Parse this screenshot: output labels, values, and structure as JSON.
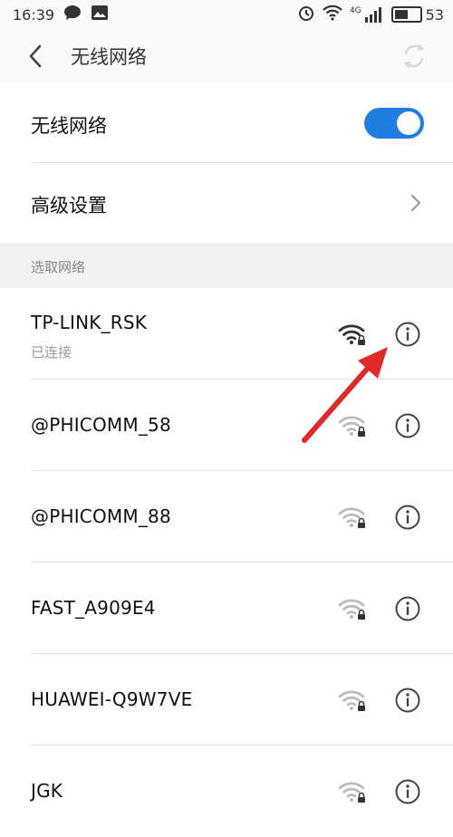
{
  "status": {
    "time": "16:39",
    "network_type": "4G",
    "battery": "53",
    "battery_level": 0.53
  },
  "header": {
    "title": "无线网络",
    "back_icon": "chevron-left-icon",
    "refresh_icon": "refresh-icon"
  },
  "wifi_toggle": {
    "label": "无线网络",
    "on": true,
    "accent": "#1e7fe0"
  },
  "advanced": {
    "label": "高级设置"
  },
  "section": {
    "title": "选取网络"
  },
  "networks": [
    {
      "ssid": "TP-LINK_RSK",
      "status": "已连接",
      "secured": true,
      "strong": true
    },
    {
      "ssid": "@PHICOMM_58",
      "status": "",
      "secured": true,
      "strong": false
    },
    {
      "ssid": "@PHICOMM_88",
      "status": "",
      "secured": true,
      "strong": false
    },
    {
      "ssid": "FAST_A909E4",
      "status": "",
      "secured": true,
      "strong": false
    },
    {
      "ssid": "HUAWEI-Q9W7VE",
      "status": "",
      "secured": true,
      "strong": false
    },
    {
      "ssid": "JGK",
      "status": "",
      "secured": true,
      "strong": false
    }
  ],
  "annotation": {
    "arrow_color": "#e02a2a"
  }
}
